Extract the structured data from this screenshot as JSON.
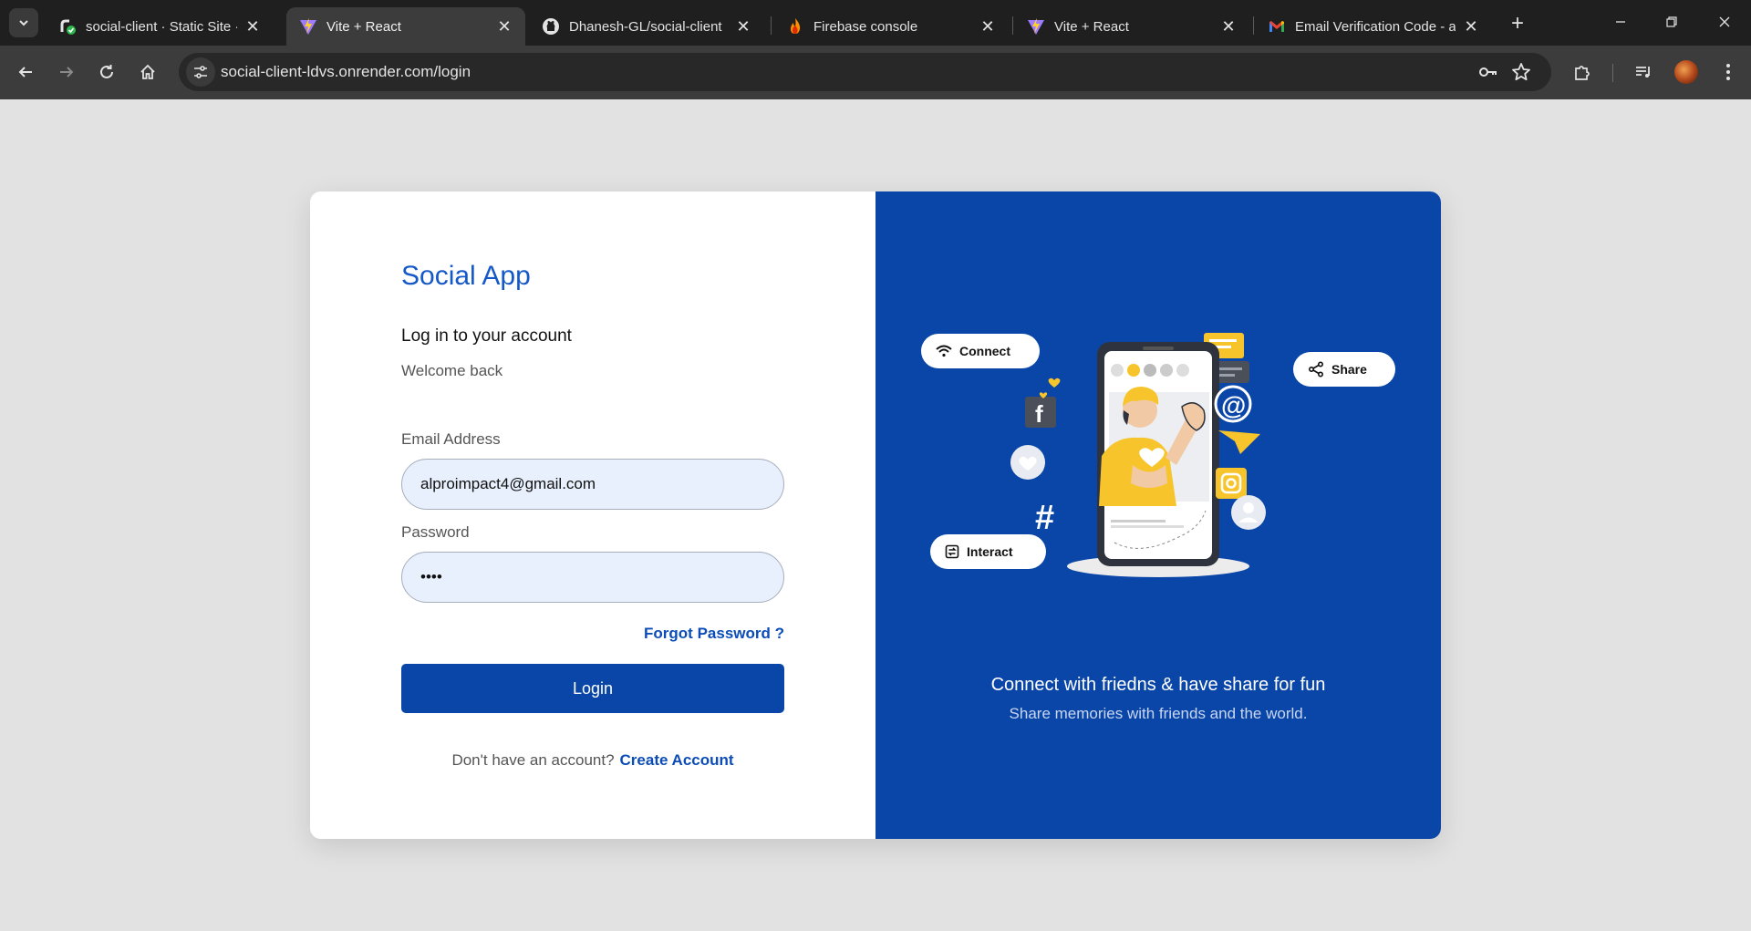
{
  "browser": {
    "tabs": [
      {
        "title": "social-client · Static Site · R",
        "icon": "render-icon"
      },
      {
        "title": "Vite + React",
        "icon": "vite-icon",
        "active": true
      },
      {
        "title": "Dhanesh-GL/social-client",
        "icon": "github-icon"
      },
      {
        "title": "Firebase console",
        "icon": "firebase-icon"
      },
      {
        "title": "Vite + React",
        "icon": "vite-icon"
      },
      {
        "title": "Email Verification Code - al",
        "icon": "gmail-icon"
      }
    ],
    "url": "social-client-ldvs.onrender.com/login"
  },
  "login": {
    "brand": "Social App",
    "heading": "Log in to your account",
    "subheading": "Welcome back",
    "email_label": "Email Address",
    "email_value": "alproimpact4@gmail.com",
    "password_label": "Password",
    "password_value": "••••",
    "forgot_link": "Forgot Password ?",
    "login_button": "Login",
    "signup_question": "Don't have an account?",
    "signup_link": "Create Account"
  },
  "promo": {
    "pills": [
      "Connect",
      "Share",
      "Interact"
    ],
    "tagline": "Connect with friedns & have share for fun",
    "subtitle": "Share memories with friends and the world."
  },
  "colors": {
    "primary": "#0a46a8",
    "link": "#0b4cb8",
    "input_bg": "#e8f0fd",
    "page_bg": "#e2e2e2",
    "chrome_dark": "#1f1f1f",
    "accent_yellow": "#f7c52b"
  }
}
